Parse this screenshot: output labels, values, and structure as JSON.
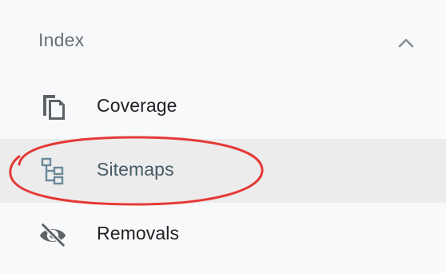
{
  "section": {
    "title": "Index",
    "collapse_icon": "chevron-up-icon"
  },
  "nav_items": [
    {
      "label": "Coverage",
      "icon": "copy-pages-icon",
      "active": false
    },
    {
      "label": "Sitemaps",
      "icon": "sitemap-tree-icon",
      "active": true
    },
    {
      "label": "Removals",
      "icon": "eye-off-icon",
      "active": false
    }
  ],
  "colors": {
    "background": "#f8f9fa",
    "active_row": "#ececec",
    "label_text": "#202124",
    "active_label": "#455a64",
    "icon_gray": "#5f6368",
    "active_icon": "#6b8a9a",
    "annotation_red": "#e53935"
  }
}
